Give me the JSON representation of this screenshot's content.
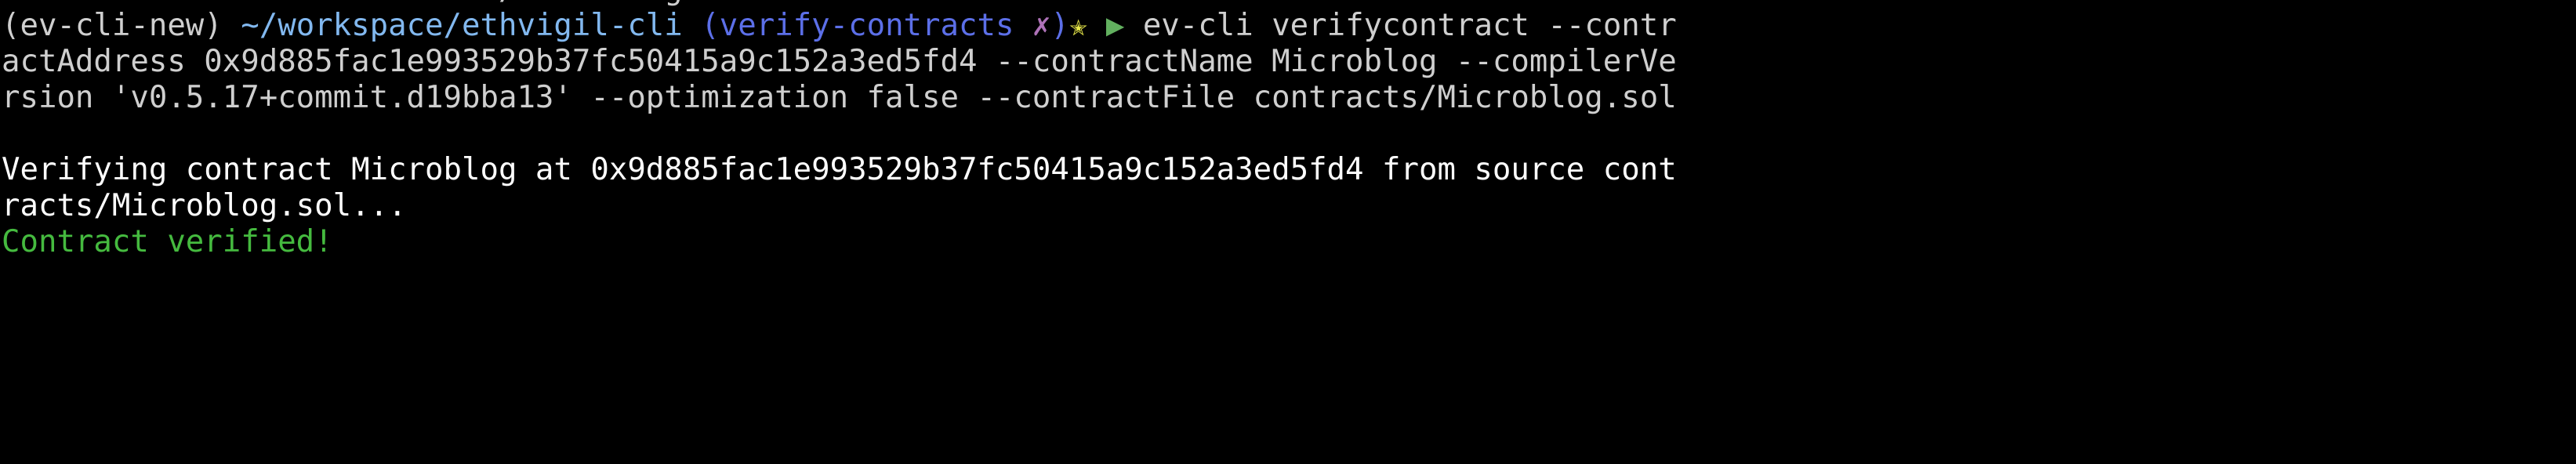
{
  "terminal": {
    "background_color": "#000000",
    "colors": {
      "venv": "#cfcfcf",
      "path": "#82b8ef",
      "branch": "#5c6fe8",
      "dirty_marker": "#ae72b8",
      "star": "#e9e94a",
      "arrow": "#62b05f",
      "command": "#cfcfcf",
      "output": "#fdfdfd",
      "success": "#45ba3f"
    },
    "clipped_top_line": "   --contractFile contracts/Microblog.sol",
    "prompt": {
      "venv": "(ev-cli-new)",
      "space_after_venv": " ",
      "path": "~/workspace/ethvigil-cli",
      "space_after_path": " ",
      "branch_open": "(verify-contracts",
      "space_before_dirty": " ",
      "dirty_marker": "✗",
      "branch_close": ")",
      "star_icon": "✭",
      "arrow_icon": "▶"
    },
    "command": {
      "full": "ev-cli verifycontract --contractAddress 0x9d885fac1e993529b37fc50415a9c152a3ed5fd4 --contractName Microblog --compilerVersion 'v0.5.17+commit.d19bba13' --optimization false --contractFile contracts/Microblog.sol",
      "wrapped_lines": [
        "ev-cli verifycontract --contr",
        "actAddress 0x9d885fac1e993529b37fc50415a9c152a3ed5fd4 --contractName Microblog --compilerVe",
        "rsion 'v0.5.17+commit.d19bba13' --optimization false --contractFile contracts/Microblog.sol"
      ]
    },
    "output": {
      "verifying": {
        "full": "Verifying contract Microblog at 0x9d885fac1e993529b37fc50415a9c152a3ed5fd4 from source contracts/Microblog.sol...",
        "wrapped_lines": [
          "Verifying contract Microblog at 0x9d885fac1e993529b37fc50415a9c152a3ed5fd4 from source cont",
          "racts/Microblog.sol..."
        ]
      },
      "result": "Contract verified!"
    }
  }
}
